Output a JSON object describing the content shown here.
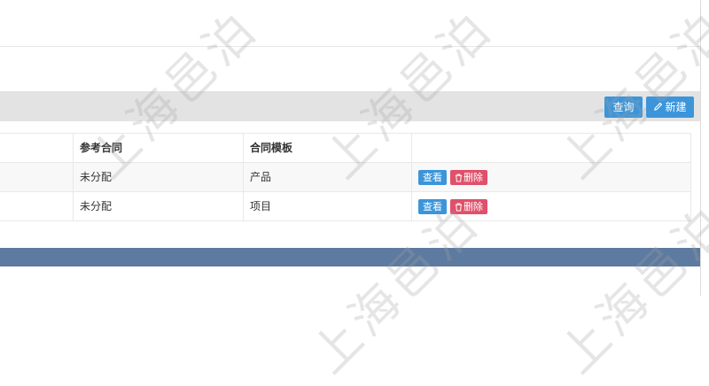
{
  "toolbar": {
    "query_label": "查询",
    "new_label": "新建"
  },
  "table": {
    "columns": {
      "ref_contract": "参考合同",
      "contract_template": "合同模板"
    },
    "rows": [
      {
        "ref_contract": "未分配",
        "contract_template": "产品",
        "view_label": "查看",
        "delete_label": "删除"
      },
      {
        "ref_contract": "未分配",
        "contract_template": "项目",
        "view_label": "查看",
        "delete_label": "删除"
      }
    ]
  },
  "watermark": {
    "text": "上海邑泊"
  },
  "colors": {
    "primary": "#3c95da",
    "danger": "#e0506a",
    "footer": "#5d7aa0",
    "toolbar_bg": "#e3e3e3"
  }
}
